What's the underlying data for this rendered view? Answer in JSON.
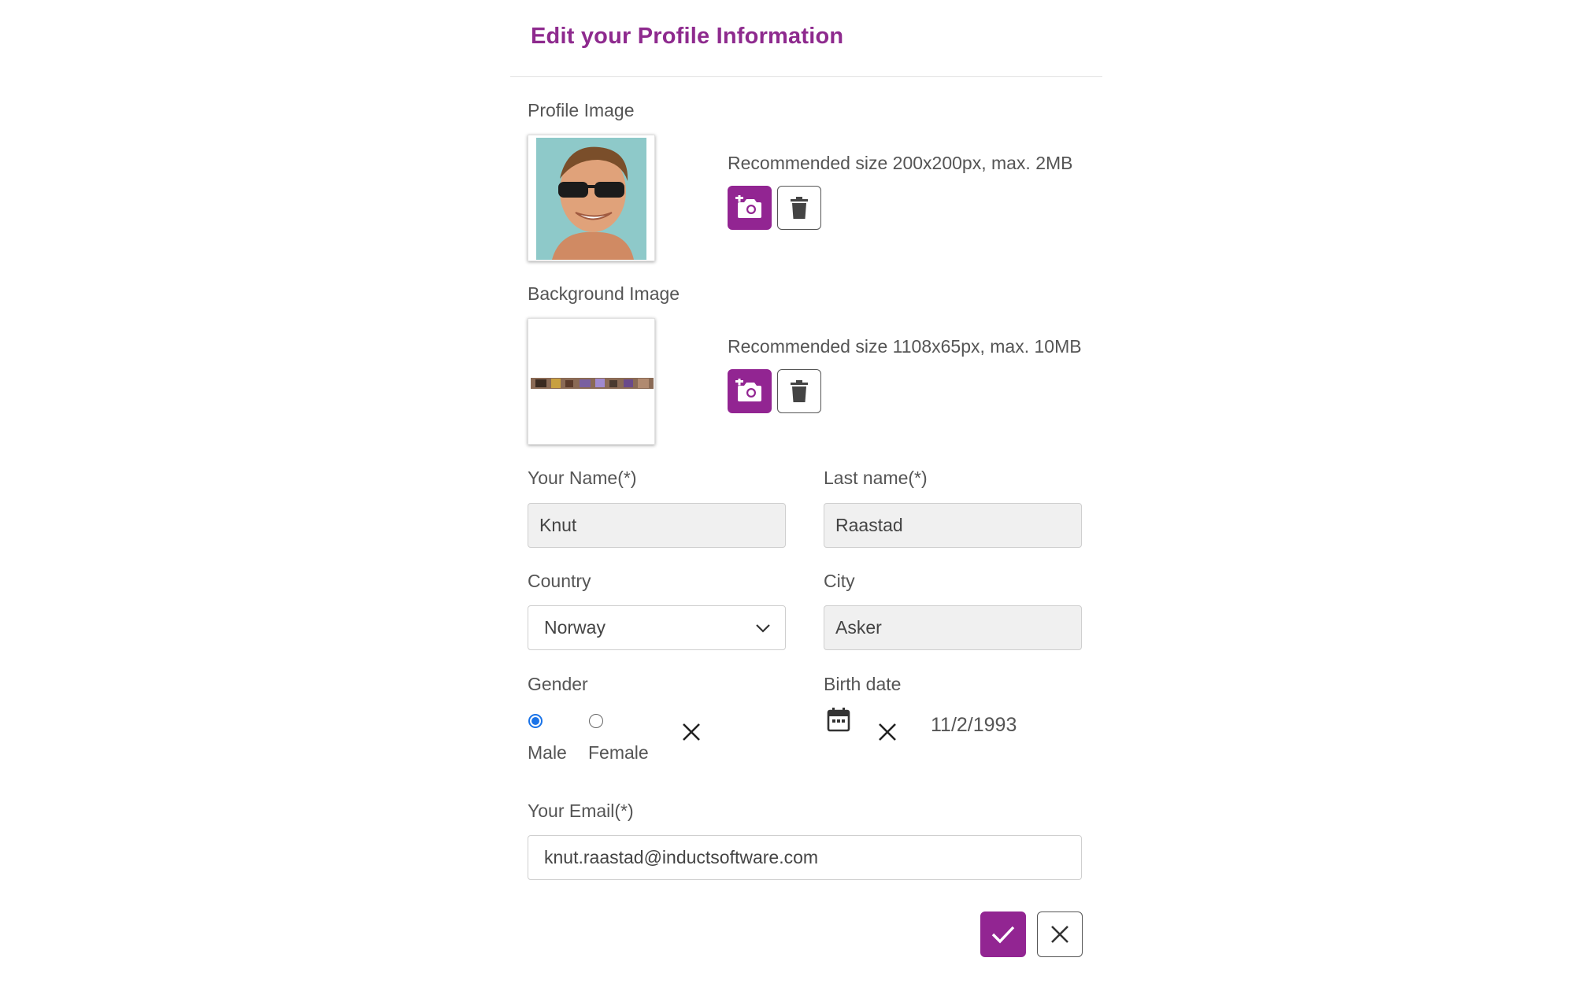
{
  "header": {
    "title": "Edit your Profile Information"
  },
  "profile_image": {
    "label": "Profile Image",
    "hint": "Recommended size 200x200px, max. 2MB"
  },
  "background_image": {
    "label": "Background Image",
    "hint": "Recommended size 1108x65px, max. 10MB"
  },
  "form": {
    "first_name": {
      "label": "Your Name(*)",
      "value": "Knut"
    },
    "last_name": {
      "label": "Last name(*)",
      "value": "Raastad"
    },
    "country": {
      "label": "Country",
      "value": "Norway"
    },
    "city": {
      "label": "City",
      "value": "Asker"
    },
    "gender": {
      "label": "Gender",
      "options": [
        "Male",
        "Female"
      ],
      "selected": "Male"
    },
    "birth_date": {
      "label": "Birth date",
      "value": "11/2/1993"
    },
    "email": {
      "label": "Your Email(*)",
      "value": "knut.raastad@inductsoftware.com"
    }
  },
  "colors": {
    "accent": "#922592",
    "title": "#8e2a8e",
    "radio": "#1a73e8"
  },
  "icons": {
    "upload": "camera-plus-icon",
    "delete": "trash-icon",
    "clear": "close-icon",
    "calendar": "calendar-icon",
    "dropdown": "chevron-down-icon",
    "save": "check-icon",
    "cancel": "close-icon"
  }
}
